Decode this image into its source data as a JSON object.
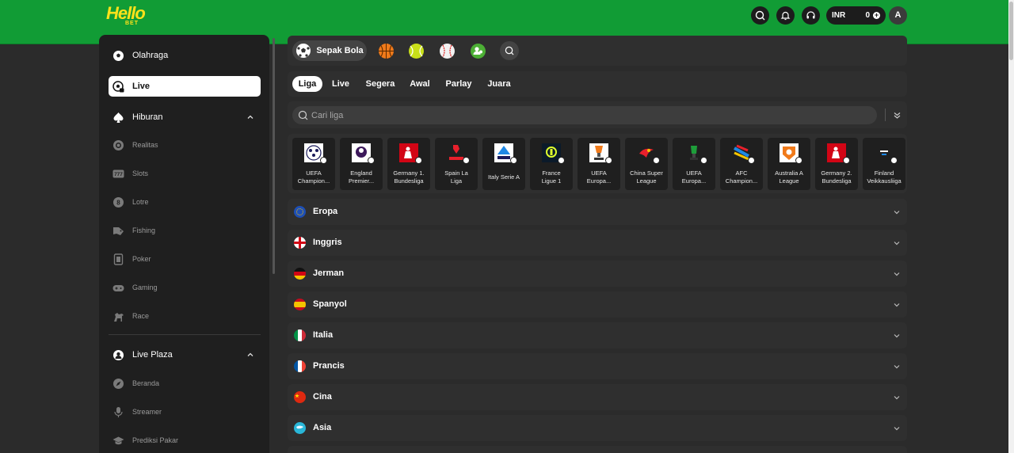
{
  "brand": {
    "logo_text": "Hello",
    "logo_sub": "BET"
  },
  "header": {
    "currency": "INR",
    "balance": "0",
    "avatar_initial": "A"
  },
  "sidebar": {
    "items": [
      {
        "label": "Olahraga"
      },
      {
        "label": "Live"
      },
      {
        "label": "Hiburan"
      },
      {
        "label": "Realitas"
      },
      {
        "label": "Slots"
      },
      {
        "label": "Lotre"
      },
      {
        "label": "Fishing"
      },
      {
        "label": "Poker"
      },
      {
        "label": "Gaming"
      },
      {
        "label": "Race"
      },
      {
        "label": "Live Plaza"
      },
      {
        "label": "Beranda"
      },
      {
        "label": "Streamer"
      },
      {
        "label": "Prediksi Pakar"
      }
    ]
  },
  "sports": {
    "active_label": "Sepak Bola"
  },
  "filters": {
    "tabs": [
      "Liga",
      "Live",
      "Segera",
      "Awal",
      "Parlay",
      "Juara"
    ]
  },
  "search": {
    "placeholder": "Cari liga"
  },
  "leagues": [
    {
      "line1": "UEFA",
      "line2": "Champion..."
    },
    {
      "line1": "England",
      "line2": "Premier..."
    },
    {
      "line1": "Germany 1.",
      "line2": "Bundesliga"
    },
    {
      "line1": "Spain La",
      "line2": "Liga"
    },
    {
      "line1": "Italy Serie A",
      "line2": ""
    },
    {
      "line1": "France",
      "line2": "Ligue 1"
    },
    {
      "line1": "UEFA",
      "line2": "Europa..."
    },
    {
      "line1": "China Super",
      "line2": "League"
    },
    {
      "line1": "UEFA",
      "line2": "Europa..."
    },
    {
      "line1": "AFC",
      "line2": "Champion..."
    },
    {
      "line1": "Australia A",
      "line2": "League"
    },
    {
      "line1": "Germany 2.",
      "line2": "Bundesliga"
    },
    {
      "line1": "Finland",
      "line2": "Veikkausliiga"
    }
  ],
  "regions": [
    "Eropa",
    "Inggris",
    "Jerman",
    "Spanyol",
    "Italia",
    "Prancis",
    "Cina",
    "Asia"
  ],
  "colors": {
    "brand_green": "#119c35",
    "logo_yellow": "#ffe21a",
    "panel": "#2f2f2f",
    "sidebar": "#1f1f1f"
  }
}
